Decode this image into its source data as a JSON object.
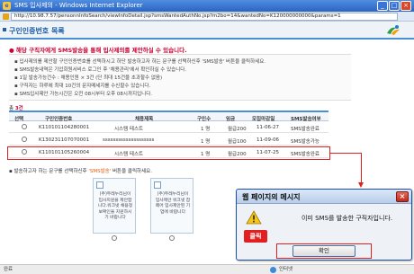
{
  "window": {
    "title": "SMS 입사제의 - Windows Internet Explorer",
    "address": "http://10.98.7.57/pensonnInfoSearch/viewInfoDetail.jsp?smsWantedAuthNo.jsp?m2bo=14&wantedNo=K120000000000&params=1",
    "status": "완료",
    "zone": "인터넷"
  },
  "header": {
    "title": "구인인증번호 목록"
  },
  "notice": {
    "title": "● 해당 구직자에게 SMS발송을 통해 입사제의를 제안하실 수 있습니다.",
    "lines": [
      "▪ 입사제의를 제안할 구인인증번호를 선택하시고 하단 발송하고자 하는 문구를 선택하신후 'SMS발송' 버튼을 클릭하세요.",
      "▪ SMS발송내역은 기업회원서비스 로그인 후 '채용관리'에서 확인하실 수 있습니다.",
      "▪ 1일 발송가능건수 : 채용인원 × 3건 (단 최대 15건을 초과할수 없음)",
      "▪ 구직자는 하루에 최대 10건의 문자메세지를 수신할수 있습니다.",
      "▪ SMS입사제안 가능시간은 오전 08시부터 오후 08시까지입니다."
    ]
  },
  "count": {
    "label": "총",
    "value": "3건"
  },
  "table": {
    "headers": [
      "선택",
      "구인인증번호",
      "채용제목",
      "구인수",
      "임금",
      "모집마감일",
      "SMS발송여부"
    ],
    "rows": [
      [
        "K110101104280001",
        "시스템 테스트",
        "1 명",
        "월급200",
        "11-06-27",
        "SMS발송완료"
      ],
      [
        "K130231107070001",
        "ssssssssssssssssssss",
        "1 명",
        "월급100",
        "11-09-06",
        "SMS발송가능"
      ],
      [
        "K110101105260004",
        "시스템 테스트",
        "1 명",
        "월급200",
        "11-07-25",
        "SMS발송완료"
      ]
    ]
  },
  "instruction": {
    "prefix": "▪ 발송하고자 하는 문구를 선택하신후 ",
    "keyword": "'SMS발송'",
    "suffix": " 버튼을 클릭하세요."
  },
  "cards": [
    {
      "text": "(주)두레누리님이 입사지원을 제안합니다.워크넷 채용정보확인을 지원하시기 바랍니다"
    },
    {
      "text": "(주)두레누리님이 입사제안 워크넷 잡페어 입사제안된 기업에 바랍니다"
    }
  ],
  "dialog": {
    "title": "웹 페이지의 메시지",
    "message": "이미 SMS를 발송한 구직자입니다.",
    "click_label": "클릭",
    "ok_label": "확인"
  },
  "colors": {
    "accent_blue": "#1f5fa8",
    "highlight_red": "#e02020"
  }
}
